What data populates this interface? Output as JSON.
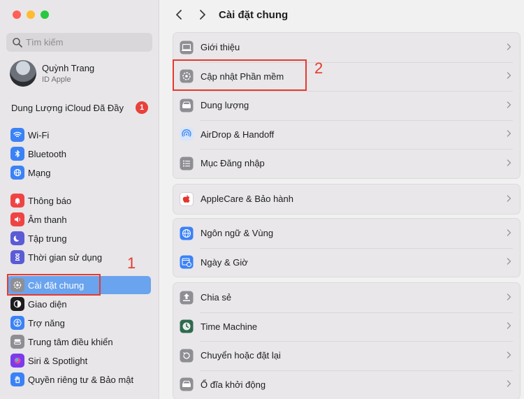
{
  "window": {
    "title": "Cài đặt chung"
  },
  "search": {
    "placeholder": "Tìm kiếm"
  },
  "profile": {
    "name": "Quỳnh Trang",
    "subtitle": "ID Apple"
  },
  "icloud": {
    "label": "Dung Lượng iCloud Đã Đầy",
    "badge": "1"
  },
  "sidebar": {
    "items": [
      {
        "label": "Wi-Fi",
        "icon": "wifi-icon",
        "color": "#3b82f6"
      },
      {
        "label": "Bluetooth",
        "icon": "bluetooth-icon",
        "color": "#3b82f6"
      },
      {
        "label": "Mạng",
        "icon": "globe-icon",
        "color": "#3b82f6"
      },
      {
        "label": "Thông báo",
        "icon": "bell-icon",
        "color": "#ef4444"
      },
      {
        "label": "Âm thanh",
        "icon": "speaker-icon",
        "color": "#ef4444"
      },
      {
        "label": "Tập trung",
        "icon": "moon-icon",
        "color": "#5b5bd6"
      },
      {
        "label": "Thời gian sử dụng",
        "icon": "hourglass-icon",
        "color": "#5b5bd6"
      },
      {
        "label": "Cài đặt chung",
        "icon": "gear-icon",
        "color": "#8e8e93",
        "active": true
      },
      {
        "label": "Giao diện",
        "icon": "appearance-icon",
        "color": "#1d1d1f"
      },
      {
        "label": "Trợ năng",
        "icon": "accessibility-icon",
        "color": "#3b82f6"
      },
      {
        "label": "Trung tâm điều khiển",
        "icon": "control-center-icon",
        "color": "#8e8e93"
      },
      {
        "label": "Siri & Spotlight",
        "icon": "siri-icon",
        "color": "#7c3aed"
      },
      {
        "label": "Quyền riêng tư & Bảo mật",
        "icon": "hand-icon",
        "color": "#3b82f6"
      }
    ]
  },
  "groups": [
    {
      "rows": [
        {
          "label": "Giới thiệu",
          "icon": "laptop-icon"
        },
        {
          "label": "Cập nhật Phần mềm",
          "icon": "software-update-icon"
        },
        {
          "label": "Dung lượng",
          "icon": "storage-icon"
        },
        {
          "label": "AirDrop & Handoff",
          "icon": "airdrop-icon"
        },
        {
          "label": "Mục Đăng nhập",
          "icon": "list-icon"
        }
      ]
    },
    {
      "rows": [
        {
          "label": "AppleCare & Bảo hành",
          "icon": "apple-icon"
        }
      ]
    },
    {
      "rows": [
        {
          "label": "Ngôn ngữ & Vùng",
          "icon": "language-globe-icon"
        },
        {
          "label": "Ngày & Giờ",
          "icon": "calendar-clock-icon"
        }
      ]
    },
    {
      "rows": [
        {
          "label": "Chia sẻ",
          "icon": "share-icon"
        },
        {
          "label": "Time Machine",
          "icon": "time-machine-icon"
        },
        {
          "label": "Chuyển hoặc đặt lại",
          "icon": "reset-icon"
        },
        {
          "label": "Ổ đĩa khởi động",
          "icon": "startup-disk-icon"
        }
      ]
    }
  ],
  "annotations": {
    "one": "1",
    "two": "2",
    "color": "#e53a2f"
  }
}
